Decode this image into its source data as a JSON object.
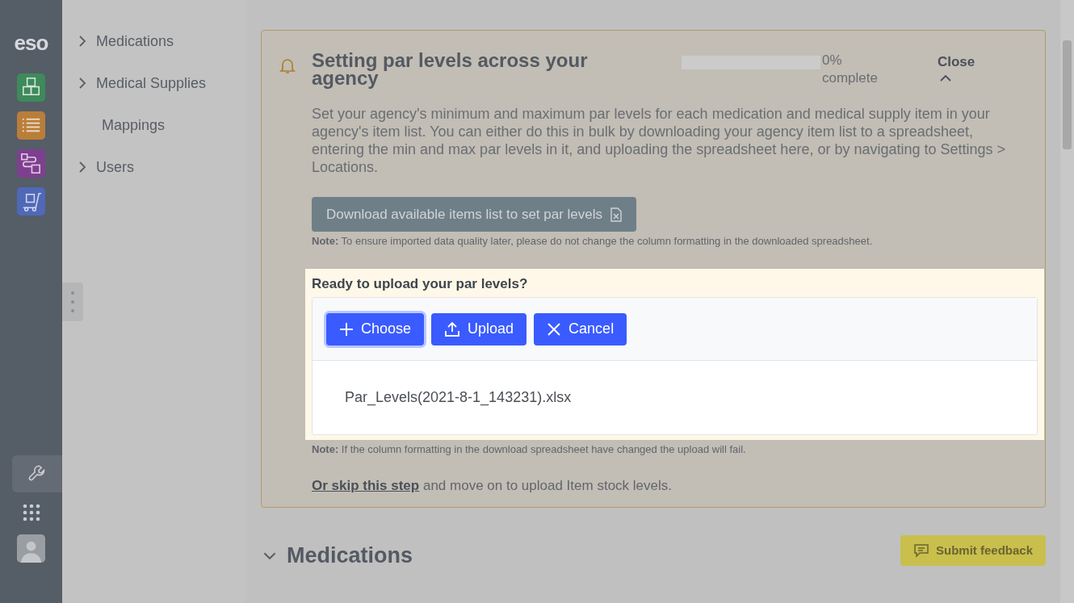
{
  "rail": {
    "logo": "eso"
  },
  "sidebar": {
    "items": [
      {
        "label": "Medications",
        "expandable": true
      },
      {
        "label": "Medical Supplies",
        "expandable": true
      },
      {
        "label": "Mappings",
        "expandable": false
      },
      {
        "label": "Users",
        "expandable": true
      }
    ]
  },
  "guide": {
    "title": "Setting par levels across your agency",
    "progress": {
      "level": 0,
      "percent": "0%",
      "caption": "complete"
    },
    "close": "Close",
    "description": "Set your agency's minimum and maximum par levels for each medication and medical supply item in your agency's item list. You can either do this in bulk by downloading your agency item list to a spreadsheet, entering the min and max par levels in it, and uploading the spreadsheet here, or by navigating to Settings > Locations.",
    "download_button": "Download available items list to set par levels",
    "download_note": "**Note:** To ensure imported data quality later, please do not change the column formatting in the downloaded spreadsheet.",
    "upload": {
      "title": "Ready to upload your par levels?",
      "buttons": [
        {
          "label": "Choose",
          "kind": "choose",
          "focused": true
        },
        {
          "label": "Upload",
          "kind": "upload",
          "focused": false
        },
        {
          "label": "Cancel",
          "kind": "cancel",
          "focused": false
        }
      ],
      "file": "Par_Levels(2021-8-1_143231).xlsx"
    },
    "upload_note": "**Note:** If the column formatting in the download spreadsheet have changed the upload will fail.",
    "skip_link": "Or skip this step",
    "skip_text": "and move on to upload Item stock levels."
  },
  "section": {
    "title": "Medications",
    "expanded": true
  },
  "feedback_button": "Submit feedback"
}
